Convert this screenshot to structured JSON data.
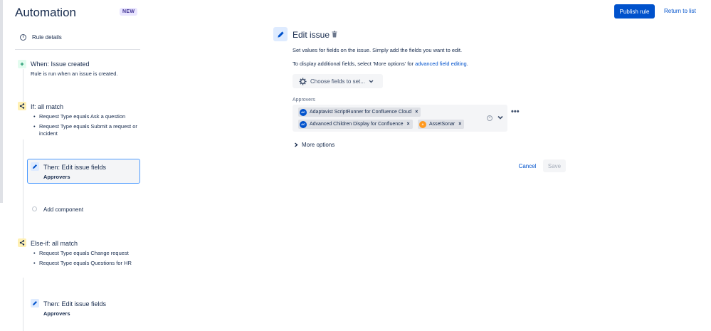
{
  "header": {
    "title": "Automation",
    "badge": "NEW",
    "publish_label": "Publish rule",
    "return_label": "Return to list"
  },
  "rail": {
    "rule_details": "Rule details",
    "trigger": {
      "title": "When: Issue created",
      "description": "Rule is run when an issue is created."
    },
    "if_block": {
      "title": "If: all match",
      "conditions": [
        "Request Type equals Ask a question",
        "Request Type equals Submit a request or incident"
      ]
    },
    "then1": {
      "title": "Then: Edit issue fields",
      "field": "Approvers"
    },
    "add_component": "Add component",
    "else_if_block": {
      "title": "Else-if: all match",
      "conditions": [
        "Request Type equals Change request",
        "Request Type equals Questions for HR"
      ]
    },
    "then2": {
      "title": "Then: Edit issue fields",
      "field": "Approvers"
    }
  },
  "panel": {
    "title": "Edit issue",
    "description": "Set values for fields on the issue. Simply add the fields you want to edit.",
    "additional_prefix": "To display additional fields, select 'More options' for ",
    "additional_link": "advanced field editing",
    "additional_suffix": ".",
    "choose_fields": "Choose fields to set...",
    "approvers_label": "Approvers",
    "chips": [
      {
        "initials": "AC",
        "label": "Adaptavist ScriptRunner for Confluence Cloud"
      },
      {
        "initials": "AC",
        "label": "Advanced Children Display for Confluence"
      },
      {
        "initials": "A",
        "label": "AssetSonar"
      }
    ],
    "more_options": "More options",
    "cancel_label": "Cancel",
    "save_label": "Save"
  },
  "colors": {
    "primary": "#0052cc",
    "selected_border": "#4c9aff",
    "condition_icon_bg": "#fff0b3",
    "trigger_icon_bg": "#e3fcef"
  }
}
